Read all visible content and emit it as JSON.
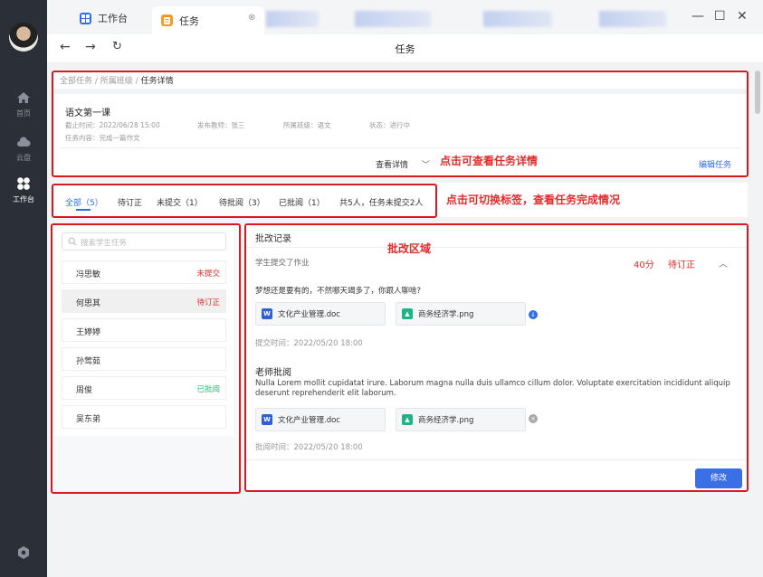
{
  "sidebar": {
    "items": [
      {
        "label": "首页",
        "icon": "home-icon"
      },
      {
        "label": "云盘",
        "icon": "cloud-icon"
      },
      {
        "label": "工作台",
        "icon": "workbench-icon"
      }
    ],
    "bottom_icon": "settings-icon"
  },
  "titlebar": {
    "tabs": [
      {
        "label": "工作台",
        "icon": "workbench-icon",
        "color": "#2f6ee7"
      },
      {
        "label": "任务",
        "icon": "task-icon",
        "color": "#f59a23"
      }
    ]
  },
  "navbar": {
    "title": "任务"
  },
  "breadcrumb": {
    "items": [
      "全部任务",
      "所属班级"
    ],
    "current": "任务详情"
  },
  "task": {
    "title": "语文第一课",
    "deadline": "截止时间：2022/06/28 15:00",
    "teacher": "发布教师：张三",
    "class": "所属班级：语文",
    "status": "状态：进行中",
    "content": "任务内容：完成一篇作文",
    "view_detail": "查看详情",
    "edit": "编辑任务"
  },
  "annotations": {
    "detail": "点击可查看任务详情",
    "tabs": "点击可切换标签，查看任务完成情况",
    "review": "批改区域"
  },
  "filter_tabs": [
    "全部（5）",
    "待订正",
    "未提交（1）",
    "待批阅（3）",
    "已批阅（1）"
  ],
  "summary": "共5人，任务未提交2人",
  "search": {
    "placeholder": "搜索学生任务"
  },
  "students": [
    {
      "name": "冯思敏",
      "status": "未提交",
      "color": "#e52a2a"
    },
    {
      "name": "何思其",
      "status": "待订正",
      "color": "#e52a2a"
    },
    {
      "name": "王婷婷",
      "status": ""
    },
    {
      "name": "孙莺茹",
      "status": ""
    },
    {
      "name": "周俊",
      "status": "已批阅",
      "color": "#2bb673"
    },
    {
      "name": "吴东弟",
      "status": ""
    }
  ],
  "review": {
    "title": "批改记录",
    "submitted": "学生提交了作业",
    "score": "40分",
    "state": "待订正",
    "message": "梦想还是要有的，不然哪天竭多了，你跟人聊啥?",
    "files1": [
      "文化产业管理.doc",
      "商务经济学.png"
    ],
    "submit_time": "提交时间：2022/05/20 18:00",
    "teacher_title": "老师批阅",
    "teacher_comment": "Nulla Lorem mollit cupidatat irure. Laborum magna nulla duis ullamco cillum dolor. Voluptate exercitation incididunt aliquip deserunt reprehenderit elit laborum.",
    "files2": [
      "文化产业管理.doc",
      "商务经济学.png"
    ],
    "review_time": "批阅时间：2022/05/20 18:00",
    "modify": "修改"
  }
}
